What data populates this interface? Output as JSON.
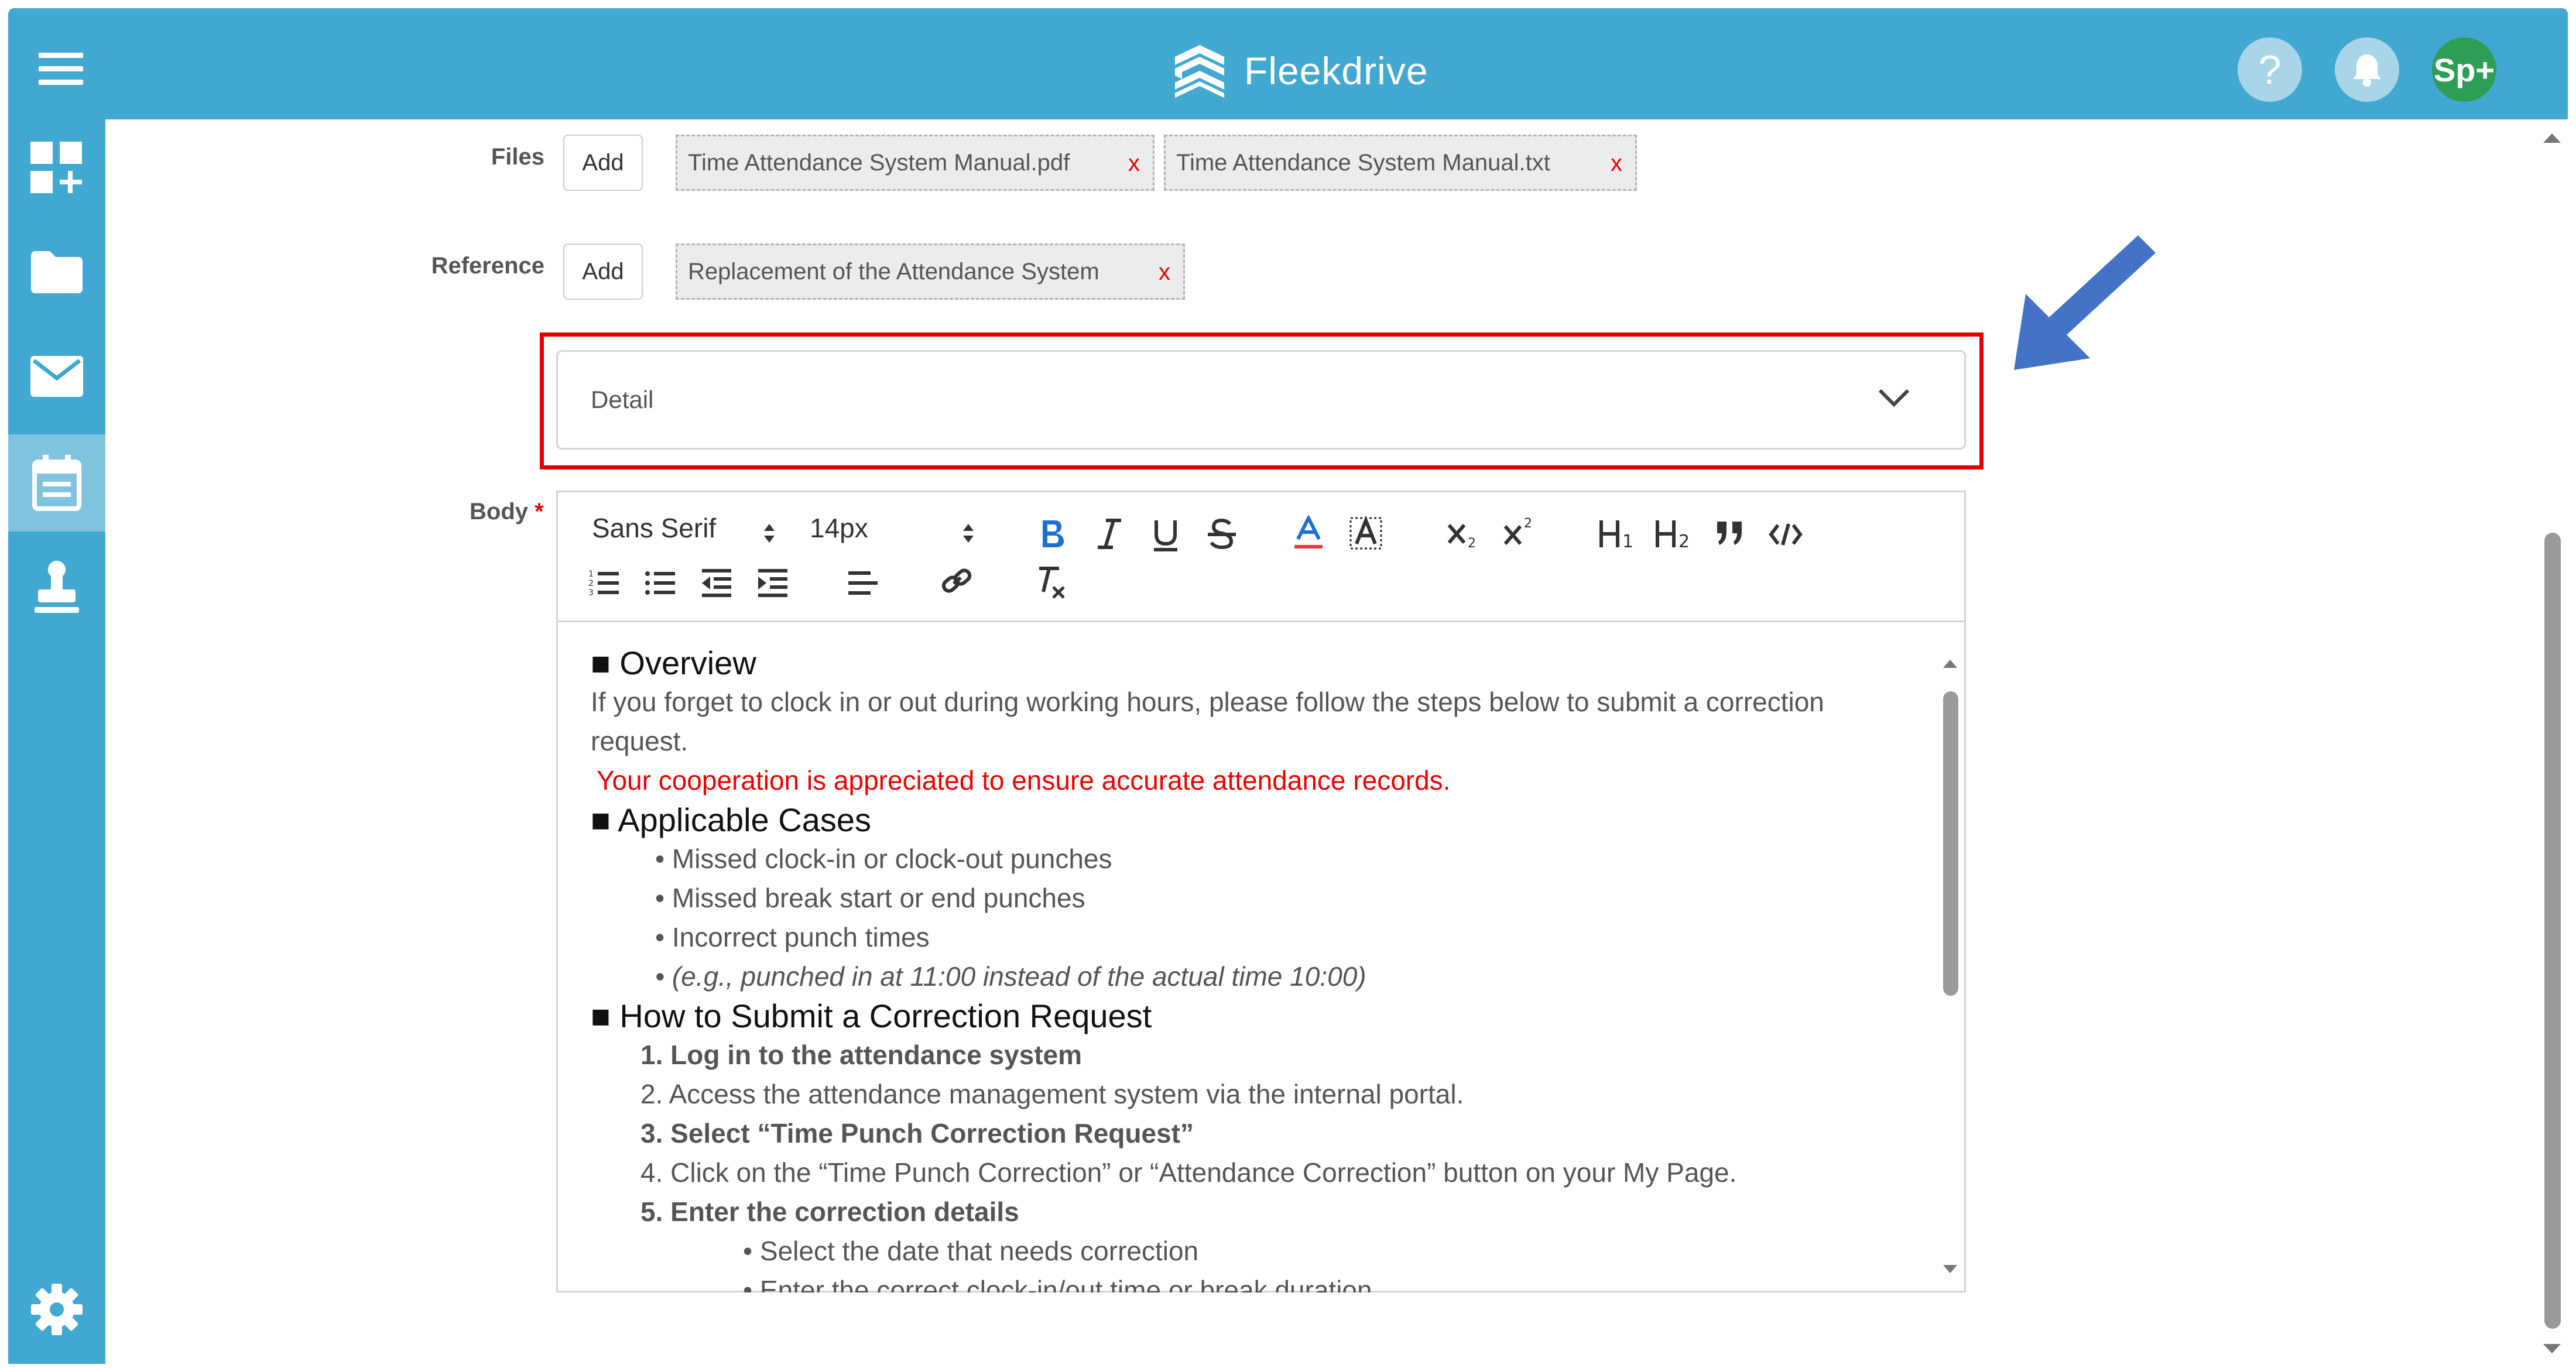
{
  "header": {
    "app_name": "Fleekdrive",
    "help_label": "?",
    "avatar_label": "Sp+",
    "colors": {
      "bar": "#41a8d1",
      "avatar": "#2e9e55"
    }
  },
  "sidebar": {
    "items": [
      {
        "icon": "dashboard-add-icon"
      },
      {
        "icon": "folder-icon"
      },
      {
        "icon": "mail-icon"
      },
      {
        "icon": "calendar-icon",
        "active": true
      },
      {
        "icon": "stamp-icon"
      },
      {
        "icon": "gear-icon"
      }
    ]
  },
  "form": {
    "files": {
      "label": "Files",
      "add_label": "Add",
      "chips": [
        "Time Attendance System Manual.pdf",
        "Time Attendance System Manual.txt"
      ],
      "remove_label": "x"
    },
    "reference": {
      "label": "Reference",
      "add_label": "Add",
      "chips": [
        "Replacement of the Attendance System"
      ],
      "remove_label": "x"
    },
    "detail": {
      "label": "Detail"
    },
    "body": {
      "label": "Body",
      "required_mark": "*",
      "toolbar": {
        "font": "Sans Serif",
        "size": "14px"
      },
      "content": {
        "overview_heading": "■ Overview",
        "overview_text_1": "If you forget to clock in or out during working hours, please follow the steps below to submit a correction",
        "overview_text_2": "request.",
        "overview_note": "Your cooperation is appreciated to ensure accurate attendance records.",
        "cases_heading": "■ Applicable Cases",
        "cases": [
          "• Missed clock-in or clock-out punches",
          "• Missed break start or end punches",
          "• Incorrect punch times",
          "• (e.g., punched in at 11:00 instead of the actual time 10:00)"
        ],
        "how_heading": "■ How to Submit a Correction Request",
        "steps": [
          "1. Log in to the attendance system",
          "2. Access the attendance management system via the internal portal.",
          "3. Select “Time Punch Correction Request”",
          "4. Click on the “Time Punch Correction” or “Attendance Correction” button on your My Page.",
          "5. Enter the correction details"
        ],
        "sub_steps": [
          "• Select the date that needs correction",
          "• Enter the correct clock-in/out time or break duration"
        ]
      }
    }
  },
  "annotation": {
    "highlight_color": "#e10000",
    "arrow_color": "#4472c4"
  }
}
